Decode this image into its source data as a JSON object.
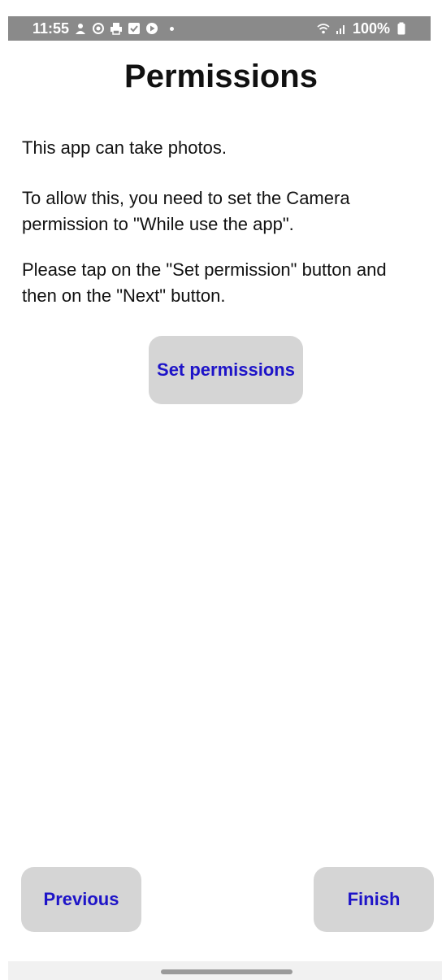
{
  "status_bar": {
    "time": "11:55",
    "battery": "100%",
    "notification_icons": [
      "person-icon",
      "at-icon",
      "printer-icon",
      "checkbox-icon",
      "play-icon"
    ],
    "status_icons": [
      "wifi-icon",
      "signal-icon",
      "battery-icon"
    ]
  },
  "page": {
    "title": "Permissions",
    "paragraph_1": "This app can take photos.",
    "paragraph_2": "To allow this, you need to set the Camera permission to \"While use the app\".",
    "paragraph_3": "Please tap on the \"Set permission\" button and then on the \"Next\" button."
  },
  "buttons": {
    "set_permissions": "Set permissions",
    "previous": "Previous",
    "finish": "Finish"
  },
  "colors": {
    "button_background": "#d5d5d5",
    "button_text": "#1e14c8",
    "status_strip": "#8a8a8a"
  }
}
